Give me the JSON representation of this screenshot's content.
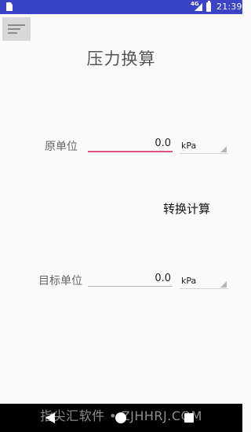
{
  "status_bar": {
    "network": "4G",
    "clock": "21:39"
  },
  "title": "压力换算",
  "source": {
    "label": "原单位",
    "value": "0.0",
    "unit": "kPa"
  },
  "convert_button": "转换计算",
  "target": {
    "label": "目标单位",
    "value": "0.0",
    "unit": "kPa"
  },
  "watermark": "指尖汇软件 • ZJHHRJ.COM",
  "icons": {
    "menu": "menu-icon",
    "sim": "sim-card-icon",
    "signal": "signal-icon",
    "battery": "battery-icon",
    "back": "back-icon",
    "home": "home-icon",
    "recent": "recent-apps-icon"
  },
  "colors": {
    "status_bar": "#3b44c6",
    "active_underline": "#e0557f",
    "background": "#fafafa"
  }
}
